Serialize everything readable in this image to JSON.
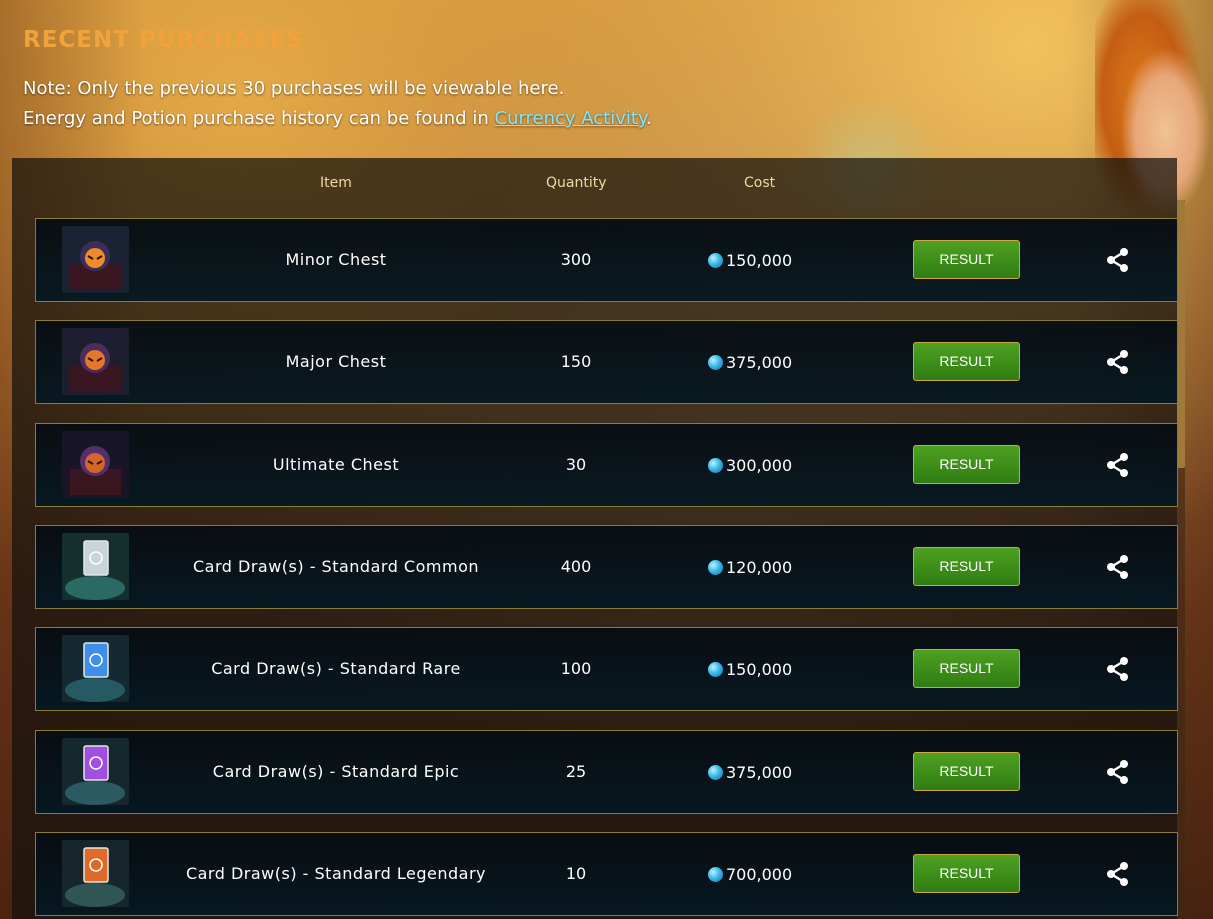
{
  "header": {
    "title": "RECENT PURCHASES",
    "note_line1": "Note: Only the previous 30 purchases will be viewable here.",
    "note_line2_prefix": "Energy and Potion purchase history can be found in ",
    "note_link": "Currency Activity",
    "note_line2_suffix": "."
  },
  "columns": {
    "item": "Item",
    "quantity": "Quantity",
    "cost": "Cost"
  },
  "rows": [
    {
      "name": "Minor Chest",
      "quantity": "300",
      "cost": "150,000",
      "result_label": "RESULT"
    },
    {
      "name": "Major Chest",
      "quantity": "150",
      "cost": "375,000",
      "result_label": "RESULT"
    },
    {
      "name": "Ultimate Chest",
      "quantity": "30",
      "cost": "300,000",
      "result_label": "RESULT"
    },
    {
      "name": "Card Draw(s) - Standard Common",
      "quantity": "400",
      "cost": "120,000",
      "result_label": "RESULT"
    },
    {
      "name": "Card Draw(s) - Standard Rare",
      "quantity": "100",
      "cost": "150,000",
      "result_label": "RESULT"
    },
    {
      "name": "Card Draw(s) - Standard Epic",
      "quantity": "25",
      "cost": "375,000",
      "result_label": "RESULT"
    },
    {
      "name": "Card Draw(s) - Standard Legendary",
      "quantity": "10",
      "cost": "700,000",
      "result_label": "RESULT"
    }
  ],
  "icons": {
    "thumbnails": [
      "minor-chest-icon",
      "major-chest-icon",
      "ultimate-chest-icon",
      "common-card-icon",
      "rare-card-icon",
      "epic-card-icon",
      "legendary-card-icon"
    ],
    "currency": "gem-icon",
    "share": "share-icon"
  },
  "colors": {
    "title": "#f0a23c",
    "link": "#7fe7ff",
    "result_button": "#3c8f1a",
    "row_border": "#8a7a3c"
  }
}
